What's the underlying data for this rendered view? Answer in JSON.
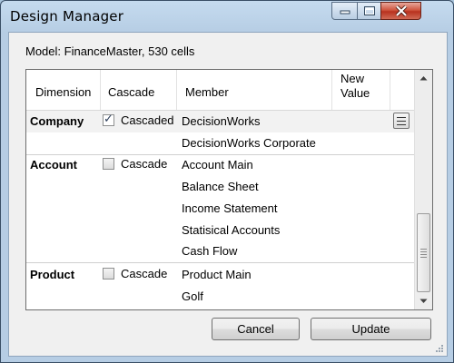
{
  "window": {
    "title": "Design Manager"
  },
  "model_label": "Model: FinanceMaster, 530 cells",
  "grid": {
    "columns": [
      "Dimension",
      "Cascade",
      "Member",
      "New Value"
    ],
    "groups": [
      {
        "dimension": "Company",
        "cascade_checked": true,
        "cascade_label": "Cascaded",
        "members": [
          "DecisionWorks",
          "DecisionWorks Corporate"
        ]
      },
      {
        "dimension": "Account",
        "cascade_checked": false,
        "cascade_label": "Cascade",
        "members": [
          "Account Main",
          "Balance Sheet",
          "Income Statement",
          "Statisical Accounts",
          "Cash Flow"
        ]
      },
      {
        "dimension": "Product",
        "cascade_checked": false,
        "cascade_label": "Cascade",
        "members": [
          "Product Main",
          "Golf"
        ]
      }
    ]
  },
  "buttons": {
    "cancel": "Cancel",
    "update": "Update"
  },
  "icons": {
    "minimize": "minimize-icon",
    "maximize": "maximize-icon",
    "close": "close-icon",
    "row_menu": "menu-icon",
    "scroll_up": "chevron-up-icon",
    "scroll_down": "chevron-down-icon"
  }
}
